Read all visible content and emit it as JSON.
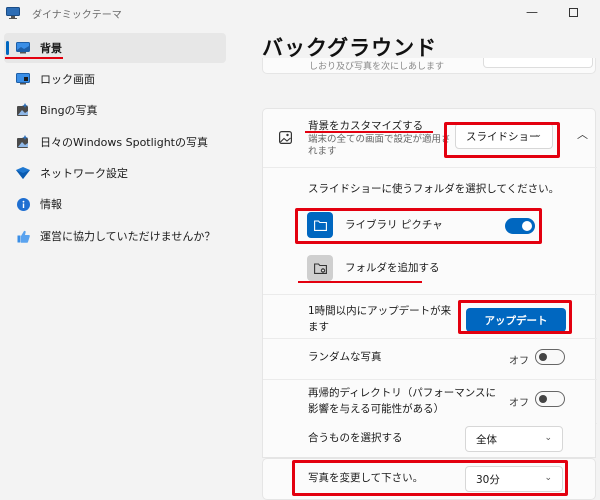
{
  "window": {
    "title": "ダイナミックテーマ",
    "minimize_glyph": "—",
    "accent_color": "#0067c0",
    "highlight_color": "#e3000f"
  },
  "sidebar": {
    "items": [
      {
        "label": "背景",
        "icon": "background-icon",
        "active": true
      },
      {
        "label": "ロック画面",
        "icon": "lock-screen-icon",
        "active": false
      },
      {
        "label": "Bingの写真",
        "icon": "photos-icon",
        "active": false
      },
      {
        "label": "日々のWindows Spotlightの写真",
        "icon": "photos-icon",
        "active": false
      },
      {
        "label": "ネットワーク設定",
        "icon": "network-icon",
        "active": false
      },
      {
        "label": "情報",
        "icon": "info-icon",
        "active": false
      },
      {
        "label": "運営に協力していただけませんか？",
        "icon": "thumbs-up-icon",
        "active": false
      }
    ]
  },
  "main": {
    "page_title": "バックグラウンド",
    "partial_text": "しおり及び写真を次にしあします",
    "customize": {
      "label": "背景をカスタマイズする",
      "sub": "端末の全ての画面で設定が適用されます",
      "dropdown_value": "スライドショー",
      "collapse_glyph": "︿"
    },
    "folder_prompt": "スライドショーに使うフォルダを選択してください。",
    "library": {
      "label": "ライブラリ ピクチャ",
      "toggle_on": true
    },
    "add_folder_label": "フォルダを追加する",
    "update": {
      "label": "1時間以内にアップデートが来ます",
      "button": "アップデート"
    },
    "random": {
      "label": "ランダムな写真",
      "state": "オフ"
    },
    "recursive": {
      "label": "再帰的ディレクトリ（パフォーマンスに影響を与える可能性がある）",
      "state": "オフ"
    },
    "fit": {
      "label": "合うものを選択する",
      "value": "全体"
    },
    "interval": {
      "label": "写真を変更して下さい。",
      "value": "30分"
    }
  }
}
